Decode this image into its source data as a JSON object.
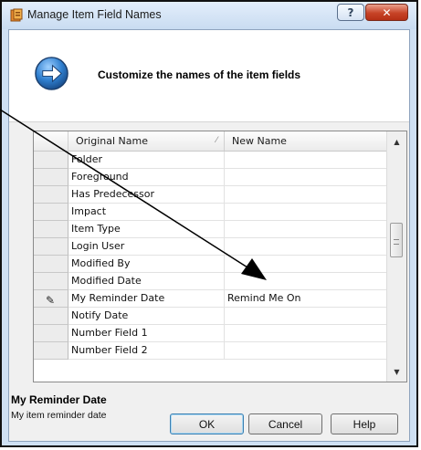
{
  "window": {
    "title": "Manage Item Field Names",
    "help_glyph": "?",
    "close_glyph": "✕"
  },
  "header": {
    "text": "Customize the names of the item fields"
  },
  "grid": {
    "columns": [
      "Original Name",
      "New Name"
    ],
    "rows": [
      {
        "original": "Folder",
        "new": ""
      },
      {
        "original": "Foreground",
        "new": ""
      },
      {
        "original": "Has Predecessor",
        "new": ""
      },
      {
        "original": "Impact",
        "new": ""
      },
      {
        "original": "Item Type",
        "new": ""
      },
      {
        "original": "Login User",
        "new": ""
      },
      {
        "original": "Modified By",
        "new": ""
      },
      {
        "original": "Modified Date",
        "new": ""
      },
      {
        "original": "My Reminder Date",
        "new": "Remind Me On",
        "editing": true
      },
      {
        "original": "Notify Date",
        "new": ""
      },
      {
        "original": "Number Field 1",
        "new": ""
      },
      {
        "original": "Number Field 2",
        "new": ""
      }
    ]
  },
  "description": {
    "title": "My Reminder Date",
    "text": "My item reminder date"
  },
  "buttons": {
    "ok": "OK",
    "cancel": "Cancel",
    "help": "Help"
  },
  "colors": {
    "close_button": "#c74327",
    "arrow_badge": "#2f7fcf",
    "annotation_line": "#000000"
  }
}
